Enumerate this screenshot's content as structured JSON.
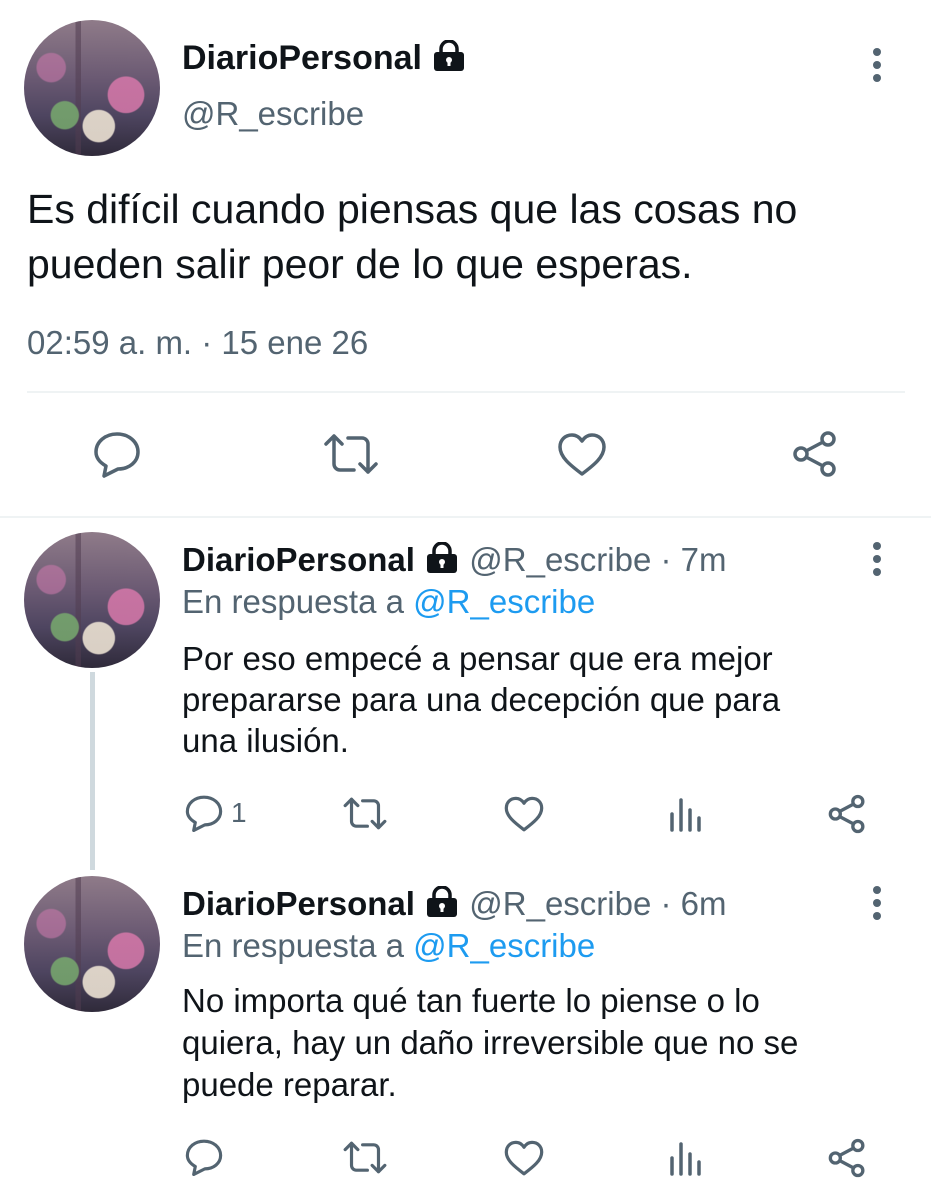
{
  "main_tweet": {
    "display_name": "DiarioPersonal",
    "handle": "@R_escribe",
    "text_line1": "Es difícil cuando piensas que las cosas no",
    "text_line2": "pueden salir peor de lo que esperas.",
    "timestamp": "02:59 a. m. · 15 ene 26"
  },
  "replies": [
    {
      "display_name": "DiarioPersonal",
      "handle_time": "@R_escribe · 7m",
      "reply_prefix": "En respuesta a",
      "reply_to": "@R_escribe",
      "line1": "Por eso empecé a pensar que era mejor",
      "line2": "prepararse para una decepción que para",
      "line3": "una ilusión.",
      "reply_count": "1"
    },
    {
      "display_name": "DiarioPersonal",
      "handle_time": "@R_escribe · 6m",
      "reply_prefix": "En respuesta a",
      "reply_to": "@R_escribe",
      "line1": "No importa qué tan fuerte lo piense o lo",
      "line2": "quiera, hay un daño irreversible que no se",
      "line3": "puede reparar.",
      "reply_count": ""
    }
  ],
  "colors": {
    "accent": "#1d9bf0",
    "muted": "#536471",
    "text": "#0f1419",
    "divider": "#eff3f4"
  },
  "icons": [
    "lock-icon",
    "more-options-icon",
    "reply-icon",
    "retweet-icon",
    "like-icon",
    "analytics-icon",
    "share-icon"
  ]
}
